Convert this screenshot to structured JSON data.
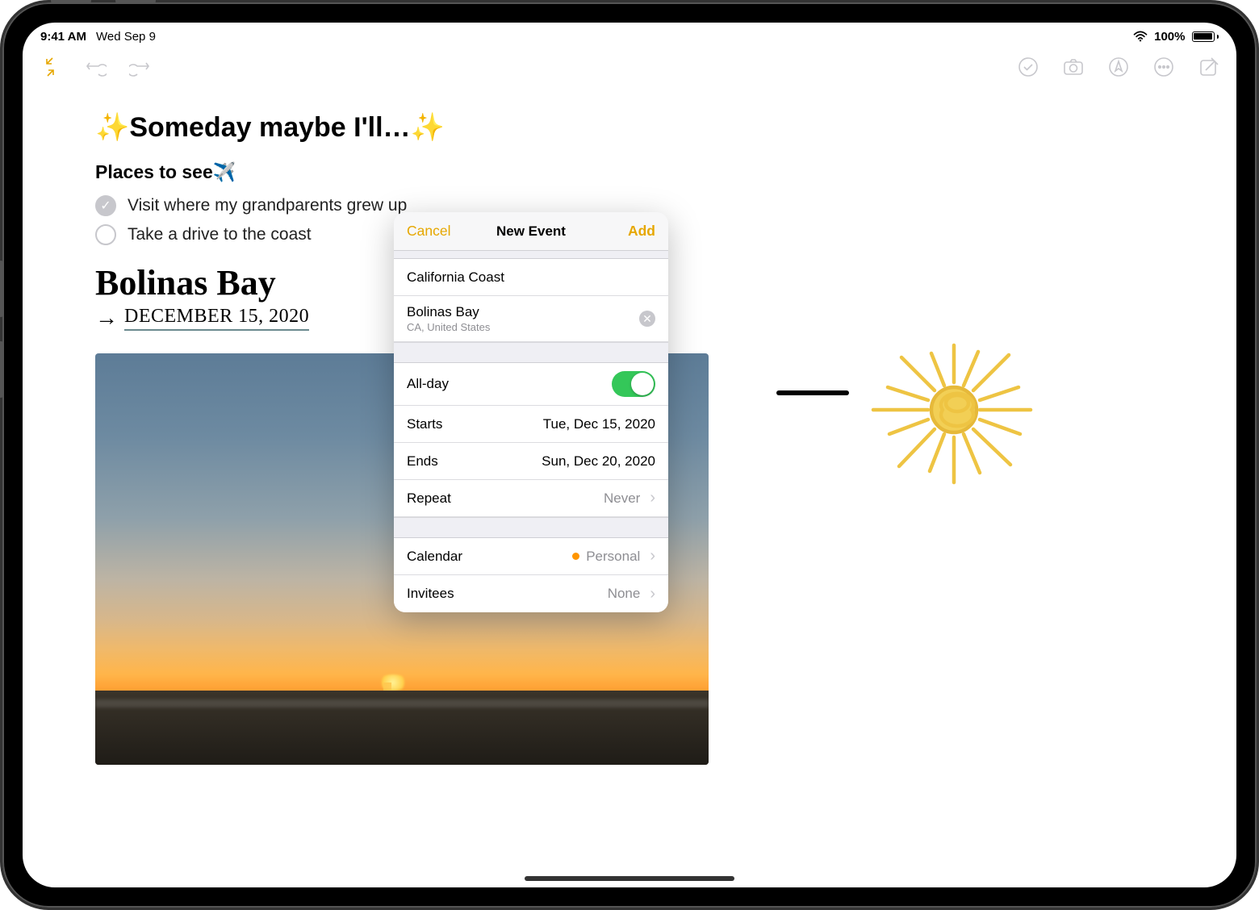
{
  "status": {
    "time": "9:41 AM",
    "date": "Wed Sep 9",
    "battery": "100%"
  },
  "note": {
    "title": "Someday maybe I'll…",
    "section": "Places to see",
    "items": [
      {
        "text": "Visit where my grandparents grew up",
        "checked": true
      },
      {
        "text": "Take a drive to the coast",
        "checked": false
      }
    ],
    "handwriting": "Bolinas Bay",
    "hand_date": "DECEMBER 15, 2020"
  },
  "popover": {
    "cancel": "Cancel",
    "title": "New Event",
    "add": "Add",
    "event_title": "California Coast",
    "location": "Bolinas Bay",
    "location_sub": "CA, United States",
    "allday_label": "All-day",
    "allday": true,
    "starts_label": "Starts",
    "starts_value": "Tue, Dec 15, 2020",
    "ends_label": "Ends",
    "ends_value": "Sun, Dec 20, 2020",
    "repeat_label": "Repeat",
    "repeat_value": "Never",
    "calendar_label": "Calendar",
    "calendar_value": "Personal",
    "invitees_label": "Invitees",
    "invitees_value": "None"
  }
}
